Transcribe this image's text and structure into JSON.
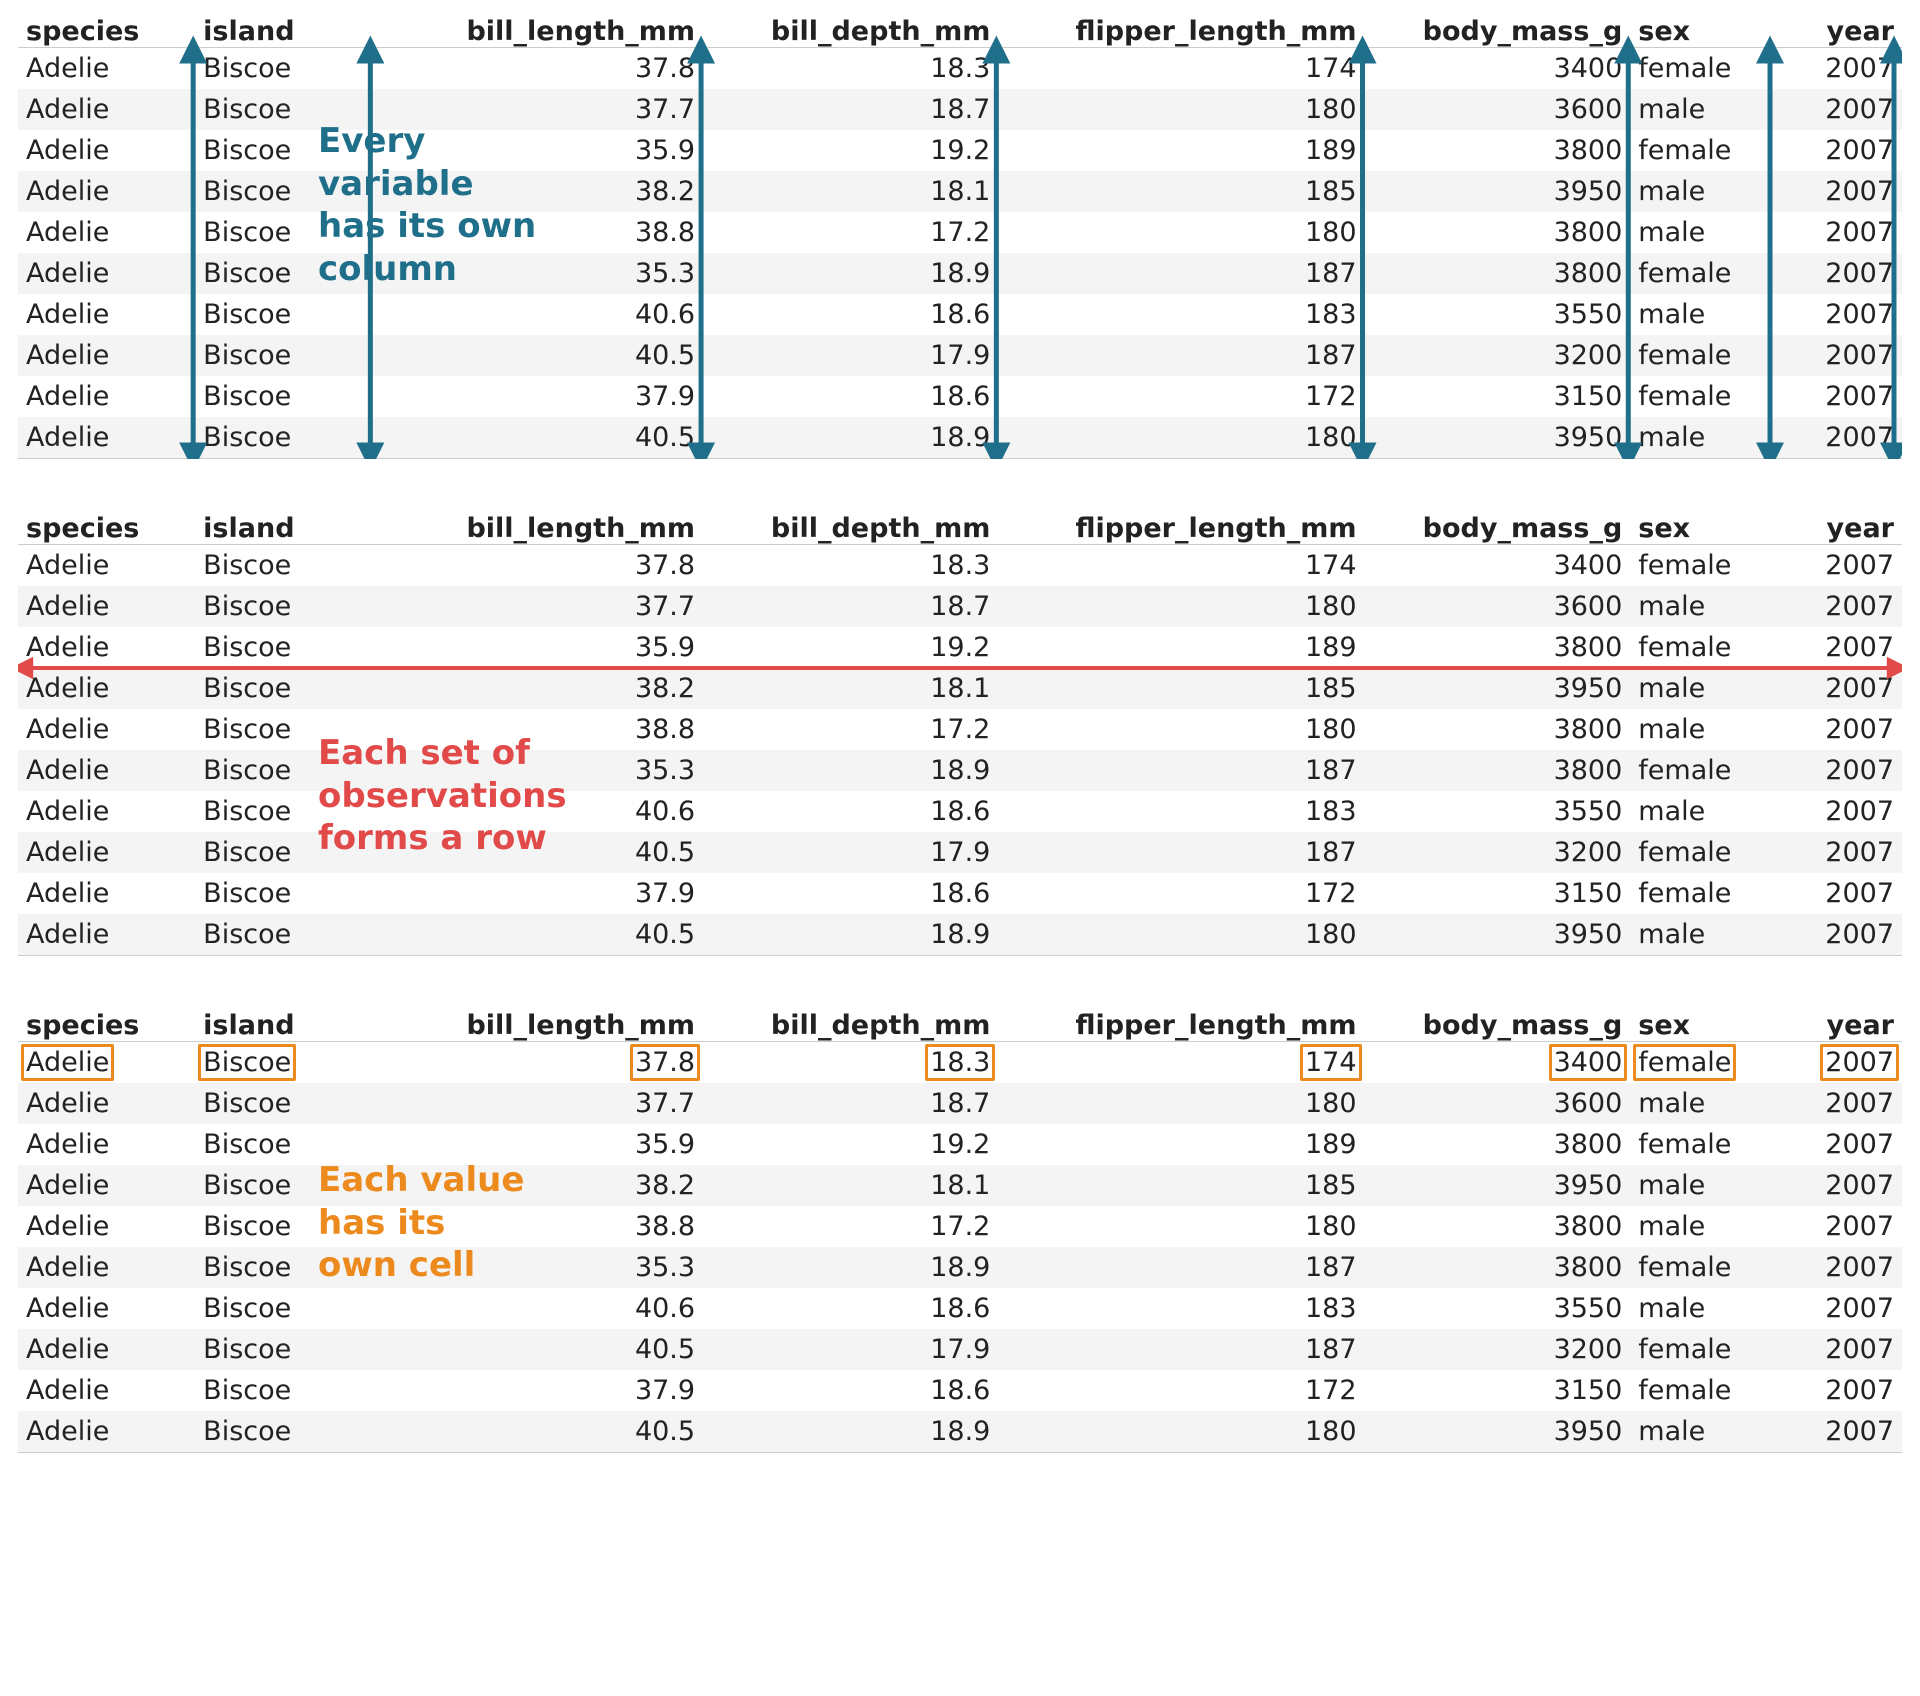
{
  "columns": [
    {
      "name": "species",
      "type": "<fctr>",
      "align": "left",
      "cls": "c-species"
    },
    {
      "name": "island",
      "type": "<fctr>",
      "align": "left",
      "cls": "c-island"
    },
    {
      "name": "bill_length_mm",
      "type": "<dbl>",
      "align": "right",
      "cls": "c-bill-l"
    },
    {
      "name": "bill_depth_mm",
      "type": "<dbl>",
      "align": "right",
      "cls": "c-bill-d"
    },
    {
      "name": "flipper_length_mm",
      "type": "<int>",
      "align": "right",
      "cls": "c-flip"
    },
    {
      "name": "body_mass_g",
      "type": "<int>",
      "align": "right",
      "cls": "c-mass"
    },
    {
      "name": "sex",
      "type": "<fctr>",
      "align": "left",
      "cls": "c-sex"
    },
    {
      "name": "year",
      "type": "<int>",
      "align": "right",
      "cls": "c-year"
    }
  ],
  "rows": [
    [
      "Adelie",
      "Biscoe",
      "37.8",
      "18.3",
      "174",
      "3400",
      "female",
      "2007"
    ],
    [
      "Adelie",
      "Biscoe",
      "37.7",
      "18.7",
      "180",
      "3600",
      "male",
      "2007"
    ],
    [
      "Adelie",
      "Biscoe",
      "35.9",
      "19.2",
      "189",
      "3800",
      "female",
      "2007"
    ],
    [
      "Adelie",
      "Biscoe",
      "38.2",
      "18.1",
      "185",
      "3950",
      "male",
      "2007"
    ],
    [
      "Adelie",
      "Biscoe",
      "38.8",
      "17.2",
      "180",
      "3800",
      "male",
      "2007"
    ],
    [
      "Adelie",
      "Biscoe",
      "35.3",
      "18.9",
      "187",
      "3800",
      "female",
      "2007"
    ],
    [
      "Adelie",
      "Biscoe",
      "40.6",
      "18.6",
      "183",
      "3550",
      "male",
      "2007"
    ],
    [
      "Adelie",
      "Biscoe",
      "40.5",
      "17.9",
      "187",
      "3200",
      "female",
      "2007"
    ],
    [
      "Adelie",
      "Biscoe",
      "37.9",
      "18.6",
      "172",
      "3150",
      "female",
      "2007"
    ],
    [
      "Adelie",
      "Biscoe",
      "40.5",
      "18.9",
      "180",
      "3950",
      "male",
      "2007"
    ]
  ],
  "annotations": {
    "columns_label": "Every\nvariable\nhas its own\ncolumn",
    "rows_label": "Each set of\nobservations\nforms a row",
    "cells_label": "Each value\nhas its\nown cell"
  },
  "colors": {
    "blue": "#1f6f8b",
    "red": "#e24a4a",
    "orange": "#ec8a1e"
  }
}
